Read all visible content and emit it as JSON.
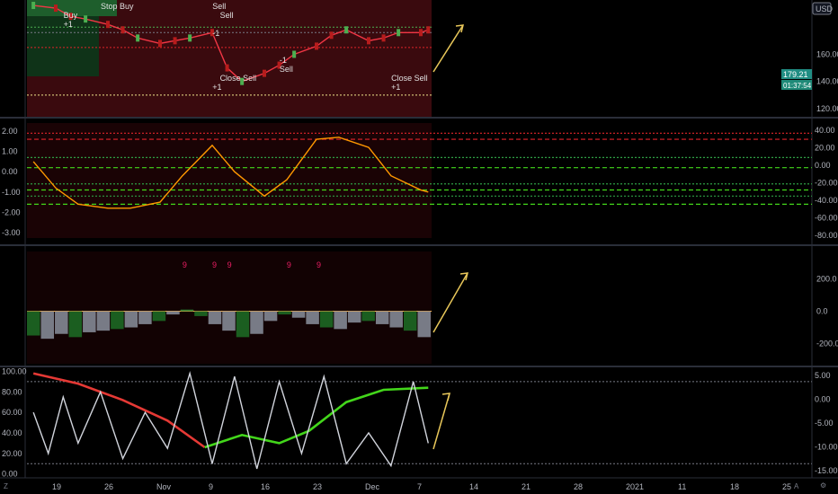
{
  "currency": "USD",
  "price_tag": "179.21",
  "countdown_tag": "01:37:54",
  "corner_left": "Z",
  "corner_mid": "A",
  "corner_right": "⚙",
  "arrow_color": "#e8c75a",
  "chart_data": [
    {
      "type": "line",
      "panel": "price",
      "yticks": [
        "160.00",
        "140.00",
        "120.00"
      ],
      "ylim": [
        114,
        200
      ],
      "signals": [
        {
          "text": "Stop Buy",
          "x": "Oct 26"
        },
        {
          "text": "Buy",
          "x": "Oct 21"
        },
        {
          "text": "+1",
          "x": "Oct 21"
        },
        {
          "text": "-1",
          "x": "Nov 10"
        },
        {
          "text": "Sell",
          "x": "Nov 10"
        },
        {
          "text": "Sell",
          "x": "Nov 11"
        },
        {
          "text": "Close Sell",
          "x": "Nov 11"
        },
        {
          "text": "+1",
          "x": "Nov 10"
        },
        {
          "text": "-1",
          "x": "Nov 19"
        },
        {
          "text": "Sell",
          "x": "Nov 19"
        },
        {
          "text": "Close Sell",
          "x": "Dec 4"
        },
        {
          "text": "+1",
          "x": "Dec 4"
        }
      ],
      "levels": [
        {
          "y": 165,
          "color": "#e0252a"
        },
        {
          "y": 180,
          "color": "#4caf50"
        },
        {
          "y": 176,
          "color": "#787b86"
        },
        {
          "y": 130,
          "color": "#f0e68c"
        }
      ],
      "price": {
        "x": [
          "Oct 16",
          "Oct 19",
          "Oct 21",
          "Oct 23",
          "Oct 26",
          "Oct 28",
          "Oct 30",
          "Nov 2",
          "Nov 4",
          "Nov 6",
          "Nov 9",
          "Nov 11",
          "Nov 13",
          "Nov 16",
          "Nov 18",
          "Nov 20",
          "Nov 23",
          "Nov 25",
          "Nov 27",
          "Nov 30",
          "Dec 2",
          "Dec 4",
          "Dec 7",
          "Dec 8"
        ],
        "y": [
          196,
          194,
          188,
          186,
          182,
          178,
          172,
          168,
          170,
          172,
          176,
          150,
          140,
          146,
          152,
          160,
          166,
          174,
          178,
          170,
          172,
          176,
          176,
          178
        ]
      }
    },
    {
      "type": "line",
      "panel": "oscillator",
      "yticks_left": [
        "2.00",
        "1.00",
        "0.00",
        "-1.00",
        "-2.00",
        "-3.00"
      ],
      "yticks_right": [
        "40.00",
        "20.00",
        "0.00",
        "-20.00",
        "-40.00",
        "-60.00",
        "-80.00"
      ],
      "ylim": [
        -3.4,
        2.4
      ],
      "series": [
        {
          "color": "#ff9800",
          "x": [
            "Oct 16",
            "Oct 19",
            "Oct 22",
            "Oct 26",
            "Oct 29",
            "Nov 2",
            "Nov 5",
            "Nov 9",
            "Nov 12",
            "Nov 16",
            "Nov 19",
            "Nov 23",
            "Nov 26",
            "Nov 30",
            "Dec 3",
            "Dec 7",
            "Dec 8"
          ],
          "y": [
            0.5,
            -0.8,
            -1.6,
            -1.8,
            -1.8,
            -1.5,
            -0.2,
            1.3,
            0.0,
            -1.2,
            -0.4,
            1.6,
            1.7,
            1.2,
            -0.2,
            -0.9,
            -1.0
          ]
        }
      ],
      "levels_left": [
        1.9,
        1.6,
        0.7,
        0.2,
        -0.6,
        -0.9,
        -1.2,
        -1.6
      ]
    },
    {
      "type": "bar",
      "panel": "histogram",
      "yticks": [
        "200.0",
        "0.0",
        "-200.0"
      ],
      "ylim": [
        -330,
        380
      ],
      "markers": [
        {
          "text": "9",
          "x": "Nov 5"
        },
        {
          "text": "9",
          "x": "Nov 9"
        },
        {
          "text": "9",
          "x": "Nov 19"
        },
        {
          "text": "9",
          "x": "Nov 23"
        },
        {
          "text": "9",
          "x": "Nov 11"
        }
      ],
      "values": [
        -150,
        -170,
        -140,
        -160,
        -130,
        -120,
        -110,
        -100,
        -80,
        -60,
        -20,
        10,
        -30,
        -80,
        -120,
        -160,
        -140,
        -60,
        -20,
        -40,
        -80,
        -100,
        -110,
        -70,
        -60,
        -80,
        -100,
        -120,
        -160
      ]
    },
    {
      "type": "line",
      "panel": "momentum",
      "yticks_left": [
        "100.00",
        "80.00",
        "60.00",
        "40.00",
        "20.00",
        "0.00"
      ],
      "yticks_right": [
        "5.00",
        "0.00",
        "-5.00",
        "-10.00",
        "-15.00"
      ],
      "ylim": [
        -2,
        103
      ],
      "series": [
        {
          "color": "#e53935",
          "x": [
            "Oct 16",
            "Oct 22",
            "Oct 28",
            "Nov 3",
            "Nov 8"
          ],
          "y": [
            98,
            88,
            72,
            52,
            26
          ]
        },
        {
          "color": "#43d61b",
          "x": [
            "Nov 8",
            "Nov 13",
            "Nov 18",
            "Nov 22",
            "Nov 27",
            "Dec 2",
            "Dec 8"
          ],
          "y": [
            26,
            38,
            30,
            42,
            70,
            82,
            84
          ]
        },
        {
          "color": "#d1d4dc",
          "x": [
            "Oct 16",
            "Oct 18",
            "Oct 20",
            "Oct 22",
            "Oct 25",
            "Oct 28",
            "Oct 31",
            "Nov 3",
            "Nov 6",
            "Nov 9",
            "Nov 12",
            "Nov 15",
            "Nov 18",
            "Nov 21",
            "Nov 24",
            "Nov 27",
            "Nov 30",
            "Dec 3",
            "Dec 6",
            "Dec 8"
          ],
          "y": [
            60,
            20,
            75,
            30,
            80,
            15,
            60,
            25,
            98,
            10,
            95,
            5,
            90,
            20,
            95,
            10,
            40,
            8,
            90,
            30
          ]
        }
      ],
      "levels": [
        90,
        10
      ]
    }
  ],
  "xaxis": [
    "19",
    "26",
    "Nov",
    "9",
    "16",
    "23",
    "Dec",
    "7",
    "14",
    "21",
    "28",
    "2021",
    "11",
    "18",
    "25"
  ]
}
